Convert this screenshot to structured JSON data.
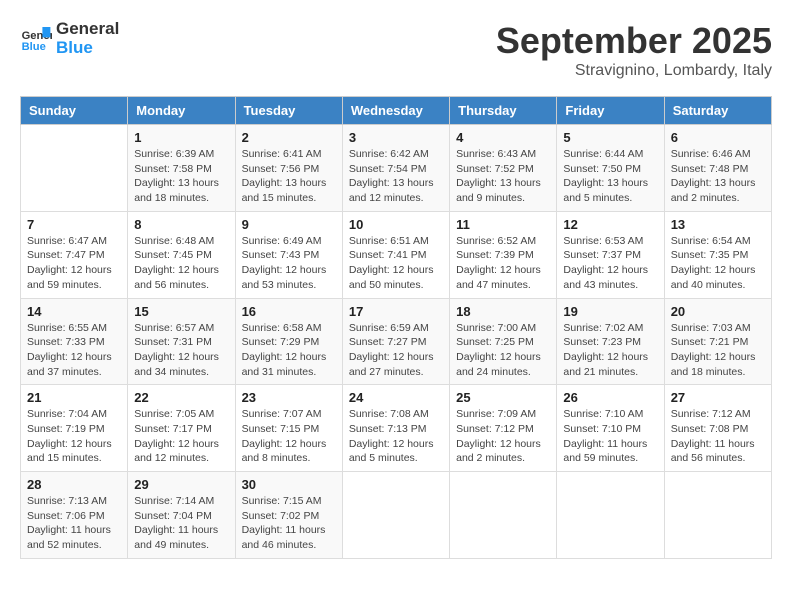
{
  "header": {
    "logo_general": "General",
    "logo_blue": "Blue",
    "month": "September 2025",
    "location": "Stravignino, Lombardy, Italy"
  },
  "days_of_week": [
    "Sunday",
    "Monday",
    "Tuesday",
    "Wednesday",
    "Thursday",
    "Friday",
    "Saturday"
  ],
  "weeks": [
    [
      {
        "day": "",
        "sunrise": "",
        "sunset": "",
        "daylight": ""
      },
      {
        "day": "1",
        "sunrise": "Sunrise: 6:39 AM",
        "sunset": "Sunset: 7:58 PM",
        "daylight": "Daylight: 13 hours and 18 minutes."
      },
      {
        "day": "2",
        "sunrise": "Sunrise: 6:41 AM",
        "sunset": "Sunset: 7:56 PM",
        "daylight": "Daylight: 13 hours and 15 minutes."
      },
      {
        "day": "3",
        "sunrise": "Sunrise: 6:42 AM",
        "sunset": "Sunset: 7:54 PM",
        "daylight": "Daylight: 13 hours and 12 minutes."
      },
      {
        "day": "4",
        "sunrise": "Sunrise: 6:43 AM",
        "sunset": "Sunset: 7:52 PM",
        "daylight": "Daylight: 13 hours and 9 minutes."
      },
      {
        "day": "5",
        "sunrise": "Sunrise: 6:44 AM",
        "sunset": "Sunset: 7:50 PM",
        "daylight": "Daylight: 13 hours and 5 minutes."
      },
      {
        "day": "6",
        "sunrise": "Sunrise: 6:46 AM",
        "sunset": "Sunset: 7:48 PM",
        "daylight": "Daylight: 13 hours and 2 minutes."
      }
    ],
    [
      {
        "day": "7",
        "sunrise": "Sunrise: 6:47 AM",
        "sunset": "Sunset: 7:47 PM",
        "daylight": "Daylight: 12 hours and 59 minutes."
      },
      {
        "day": "8",
        "sunrise": "Sunrise: 6:48 AM",
        "sunset": "Sunset: 7:45 PM",
        "daylight": "Daylight: 12 hours and 56 minutes."
      },
      {
        "day": "9",
        "sunrise": "Sunrise: 6:49 AM",
        "sunset": "Sunset: 7:43 PM",
        "daylight": "Daylight: 12 hours and 53 minutes."
      },
      {
        "day": "10",
        "sunrise": "Sunrise: 6:51 AM",
        "sunset": "Sunset: 7:41 PM",
        "daylight": "Daylight: 12 hours and 50 minutes."
      },
      {
        "day": "11",
        "sunrise": "Sunrise: 6:52 AM",
        "sunset": "Sunset: 7:39 PM",
        "daylight": "Daylight: 12 hours and 47 minutes."
      },
      {
        "day": "12",
        "sunrise": "Sunrise: 6:53 AM",
        "sunset": "Sunset: 7:37 PM",
        "daylight": "Daylight: 12 hours and 43 minutes."
      },
      {
        "day": "13",
        "sunrise": "Sunrise: 6:54 AM",
        "sunset": "Sunset: 7:35 PM",
        "daylight": "Daylight: 12 hours and 40 minutes."
      }
    ],
    [
      {
        "day": "14",
        "sunrise": "Sunrise: 6:55 AM",
        "sunset": "Sunset: 7:33 PM",
        "daylight": "Daylight: 12 hours and 37 minutes."
      },
      {
        "day": "15",
        "sunrise": "Sunrise: 6:57 AM",
        "sunset": "Sunset: 7:31 PM",
        "daylight": "Daylight: 12 hours and 34 minutes."
      },
      {
        "day": "16",
        "sunrise": "Sunrise: 6:58 AM",
        "sunset": "Sunset: 7:29 PM",
        "daylight": "Daylight: 12 hours and 31 minutes."
      },
      {
        "day": "17",
        "sunrise": "Sunrise: 6:59 AM",
        "sunset": "Sunset: 7:27 PM",
        "daylight": "Daylight: 12 hours and 27 minutes."
      },
      {
        "day": "18",
        "sunrise": "Sunrise: 7:00 AM",
        "sunset": "Sunset: 7:25 PM",
        "daylight": "Daylight: 12 hours and 24 minutes."
      },
      {
        "day": "19",
        "sunrise": "Sunrise: 7:02 AM",
        "sunset": "Sunset: 7:23 PM",
        "daylight": "Daylight: 12 hours and 21 minutes."
      },
      {
        "day": "20",
        "sunrise": "Sunrise: 7:03 AM",
        "sunset": "Sunset: 7:21 PM",
        "daylight": "Daylight: 12 hours and 18 minutes."
      }
    ],
    [
      {
        "day": "21",
        "sunrise": "Sunrise: 7:04 AM",
        "sunset": "Sunset: 7:19 PM",
        "daylight": "Daylight: 12 hours and 15 minutes."
      },
      {
        "day": "22",
        "sunrise": "Sunrise: 7:05 AM",
        "sunset": "Sunset: 7:17 PM",
        "daylight": "Daylight: 12 hours and 12 minutes."
      },
      {
        "day": "23",
        "sunrise": "Sunrise: 7:07 AM",
        "sunset": "Sunset: 7:15 PM",
        "daylight": "Daylight: 12 hours and 8 minutes."
      },
      {
        "day": "24",
        "sunrise": "Sunrise: 7:08 AM",
        "sunset": "Sunset: 7:13 PM",
        "daylight": "Daylight: 12 hours and 5 minutes."
      },
      {
        "day": "25",
        "sunrise": "Sunrise: 7:09 AM",
        "sunset": "Sunset: 7:12 PM",
        "daylight": "Daylight: 12 hours and 2 minutes."
      },
      {
        "day": "26",
        "sunrise": "Sunrise: 7:10 AM",
        "sunset": "Sunset: 7:10 PM",
        "daylight": "Daylight: 11 hours and 59 minutes."
      },
      {
        "day": "27",
        "sunrise": "Sunrise: 7:12 AM",
        "sunset": "Sunset: 7:08 PM",
        "daylight": "Daylight: 11 hours and 56 minutes."
      }
    ],
    [
      {
        "day": "28",
        "sunrise": "Sunrise: 7:13 AM",
        "sunset": "Sunset: 7:06 PM",
        "daylight": "Daylight: 11 hours and 52 minutes."
      },
      {
        "day": "29",
        "sunrise": "Sunrise: 7:14 AM",
        "sunset": "Sunset: 7:04 PM",
        "daylight": "Daylight: 11 hours and 49 minutes."
      },
      {
        "day": "30",
        "sunrise": "Sunrise: 7:15 AM",
        "sunset": "Sunset: 7:02 PM",
        "daylight": "Daylight: 11 hours and 46 minutes."
      },
      {
        "day": "",
        "sunrise": "",
        "sunset": "",
        "daylight": ""
      },
      {
        "day": "",
        "sunrise": "",
        "sunset": "",
        "daylight": ""
      },
      {
        "day": "",
        "sunrise": "",
        "sunset": "",
        "daylight": ""
      },
      {
        "day": "",
        "sunrise": "",
        "sunset": "",
        "daylight": ""
      }
    ]
  ]
}
